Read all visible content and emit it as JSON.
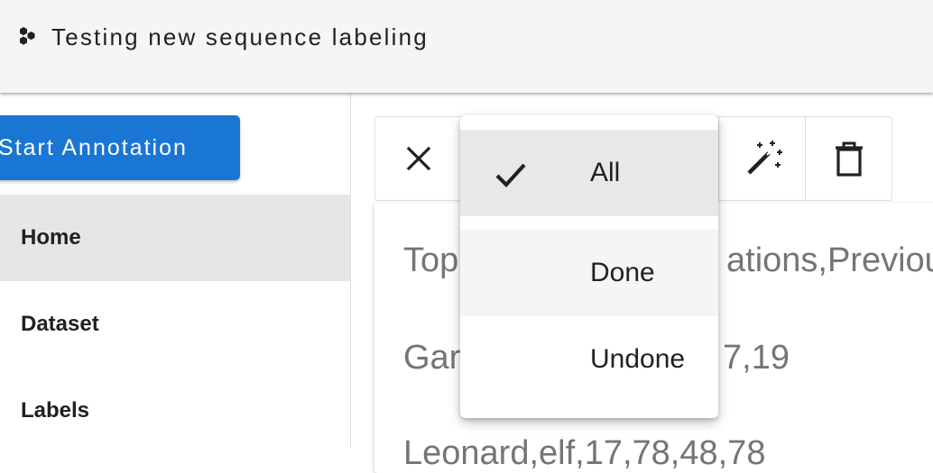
{
  "app": {
    "title": "Testing new sequence labeling",
    "logo_icon": "hexagon-cluster-icon"
  },
  "sidebar": {
    "start_button_label": "Start Annotation",
    "items": [
      {
        "label": "Home",
        "active": true
      },
      {
        "label": "Dataset",
        "active": false
      },
      {
        "label": "Labels",
        "active": false
      }
    ]
  },
  "toolbar": {
    "buttons": [
      {
        "icon": "close-icon"
      },
      {
        "icon": "auto-fix-wand-icon"
      },
      {
        "icon": "trash-icon"
      }
    ]
  },
  "filter_menu": {
    "options": [
      {
        "label": "All",
        "selected": true
      },
      {
        "label": "Done",
        "selected": false
      },
      {
        "label": "Undone",
        "selected": false
      }
    ]
  },
  "document": {
    "lines": [
      "Top",
      "ations,Previou",
      "Gar",
      "7,19",
      "Leonard,elf,17,78,48,78"
    ]
  },
  "colors": {
    "primary": "#1976d2",
    "appbar_bg": "#f5f5f5",
    "active_nav_bg": "#e6e6e6",
    "menu_selected_bg": "#e8e8e8",
    "menu_hover_bg": "#f5f5f5",
    "muted_text": "#757575"
  }
}
